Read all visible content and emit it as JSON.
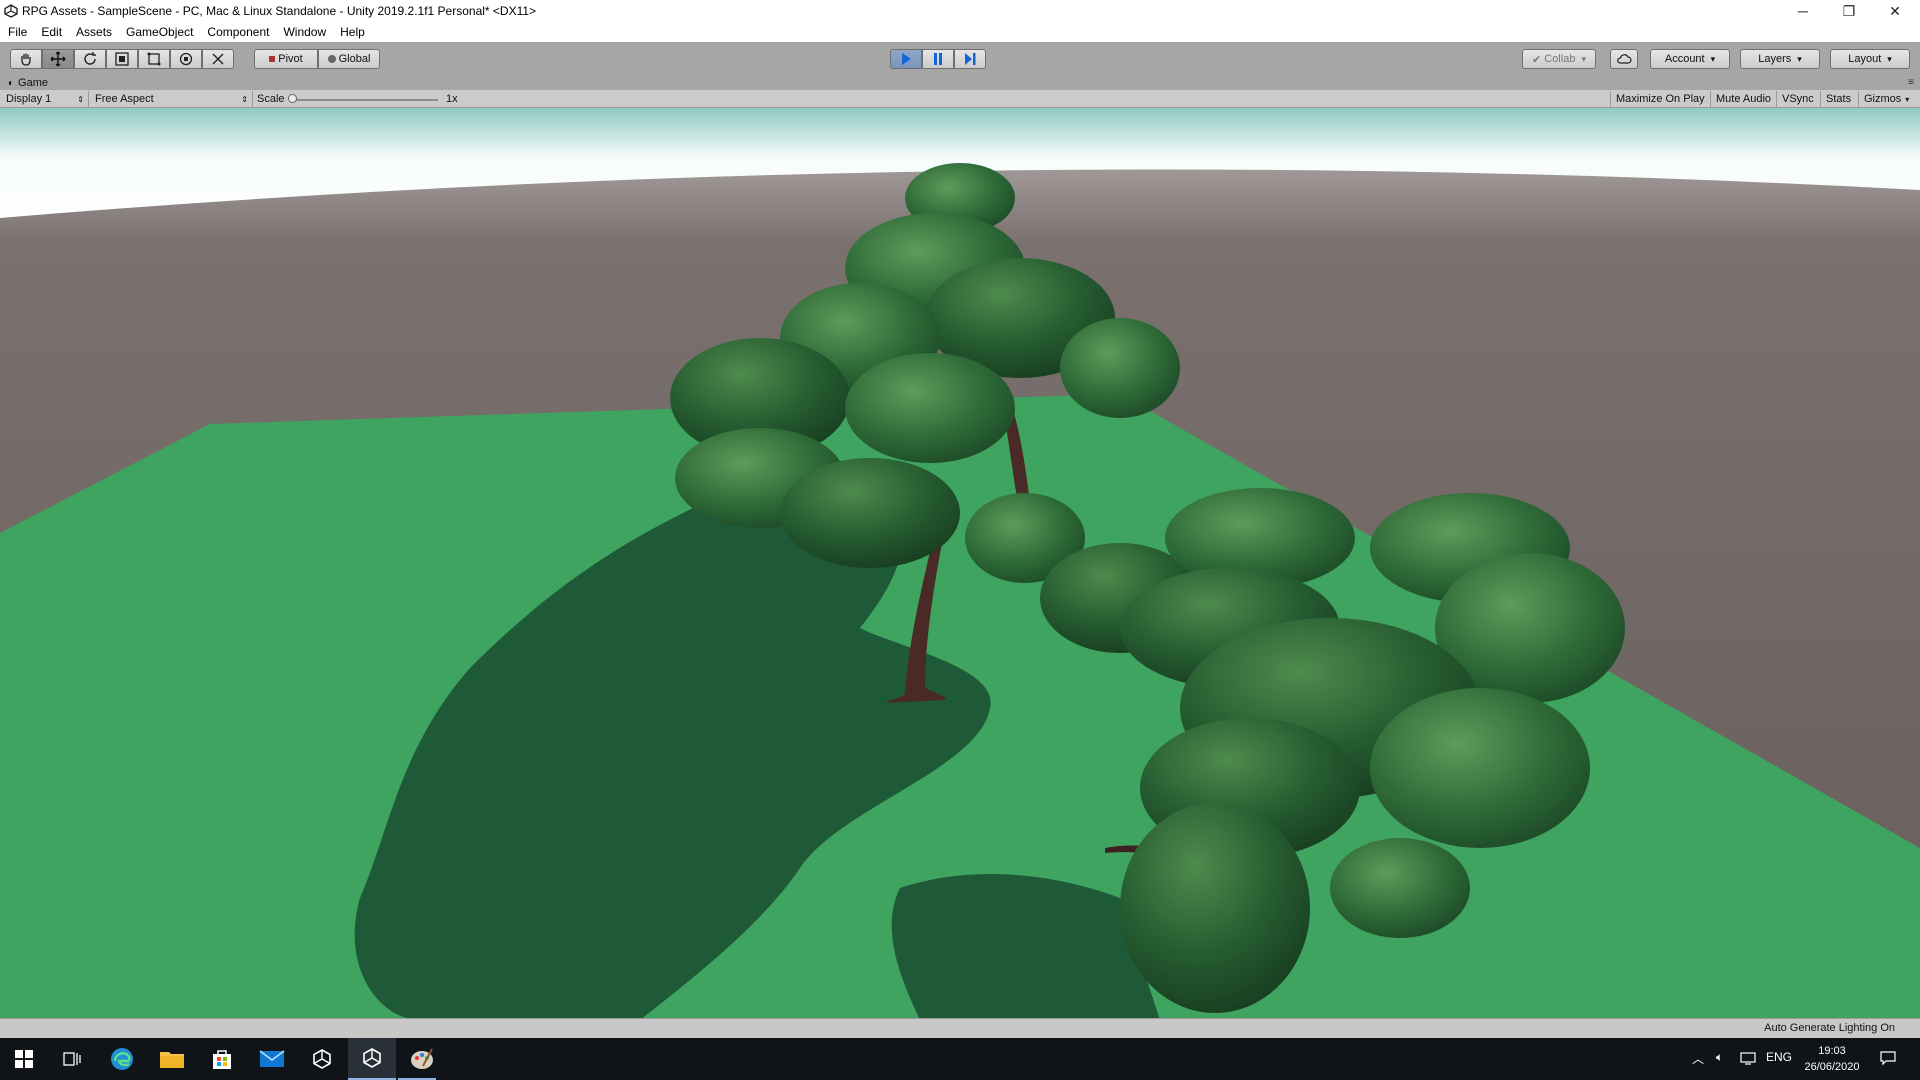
{
  "window": {
    "title": "RPG Assets - SampleScene - PC, Mac & Linux Standalone - Unity 2019.2.1f1 Personal* <DX11>",
    "minimize": "─",
    "restore": "❐",
    "close": "✕"
  },
  "menu": [
    "File",
    "Edit",
    "Assets",
    "GameObject",
    "Component",
    "Window",
    "Help"
  ],
  "toolbar": {
    "tools": [
      "hand-tool",
      "move-tool",
      "rotate-tool",
      "scale-tool",
      "rect-tool",
      "transform-tool",
      "custom-tool"
    ],
    "active_tool": "move-tool",
    "pivot_label": "Pivot",
    "global_label": "Global",
    "collab_label": "Collab",
    "account_label": "Account",
    "layers_label": "Layers",
    "layout_label": "Layout",
    "play_state": "playing"
  },
  "game_view": {
    "tab_label": "Game",
    "display": "Display 1",
    "aspect": "Free Aspect",
    "scale_label": "Scale",
    "scale_value": "1x",
    "maximize_on_play": "Maximize On Play",
    "mute_audio": "Mute Audio",
    "vsync": "VSync",
    "stats": "Stats",
    "gizmos": "Gizmos"
  },
  "status": {
    "text": "Auto Generate Lighting On"
  },
  "taskbar": {
    "apps": [
      "windows-start",
      "task-view",
      "edge",
      "file-explorer",
      "store",
      "mail",
      "unity-hub",
      "unity-editor",
      "paint"
    ],
    "active_app": "unity-editor",
    "language": "ENG",
    "time": "19:03",
    "date": "26/06/2020"
  },
  "colors": {
    "ground": "#3fa45f",
    "shadow": "#1f5a38",
    "horizon": "#6e6563",
    "sky_top": "#8fc9c3",
    "foliage": "#2e6b3a"
  }
}
